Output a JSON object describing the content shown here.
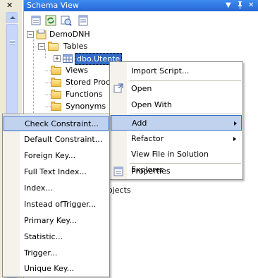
{
  "left_panel": {
    "close_glyph": "✕"
  },
  "schema_view": {
    "title": "Schema View",
    "buttons": {
      "dropdown": "▼",
      "pin": "📌",
      "close": "✕"
    },
    "toolbar_icons": [
      "properties-icon",
      "refresh-icon",
      "filter-icon",
      "new-view-icon"
    ]
  },
  "tree": {
    "root": "DemoDNH",
    "tables": "Tables",
    "selected_table": "dbo.Utente",
    "views": "Views",
    "stored_procedures": "Stored Proce",
    "functions": "Functions",
    "synonyms": "Synonyms",
    "objects_tail": "ojects"
  },
  "context_menu": {
    "items": [
      {
        "label": "Import Script...",
        "icon": ""
      },
      {
        "label": "Open",
        "icon": "open-icon"
      },
      {
        "label": "Open With",
        "icon": ""
      },
      {
        "label": "Add",
        "submenu": true,
        "selected": true
      },
      {
        "label": "Refactor",
        "submenu": true
      },
      {
        "label": "View File in Solution Explorer"
      },
      {
        "label": "Properties",
        "icon": "properties-icon"
      }
    ]
  },
  "add_submenu": {
    "items": [
      "Check Constraint...",
      "Default Constraint...",
      "Foreign Key...",
      "Full Text Index...",
      "Index...",
      "Instead ofTrigger...",
      "Primary Key...",
      "Statistic...",
      "Trigger...",
      "Unique Key..."
    ],
    "selected_index": 0
  },
  "colors": {
    "title_bar": "#2a6ad8",
    "selection": "#c1d2ee",
    "selection_border": "#316ac5",
    "tree_selected": "#316ac5"
  }
}
